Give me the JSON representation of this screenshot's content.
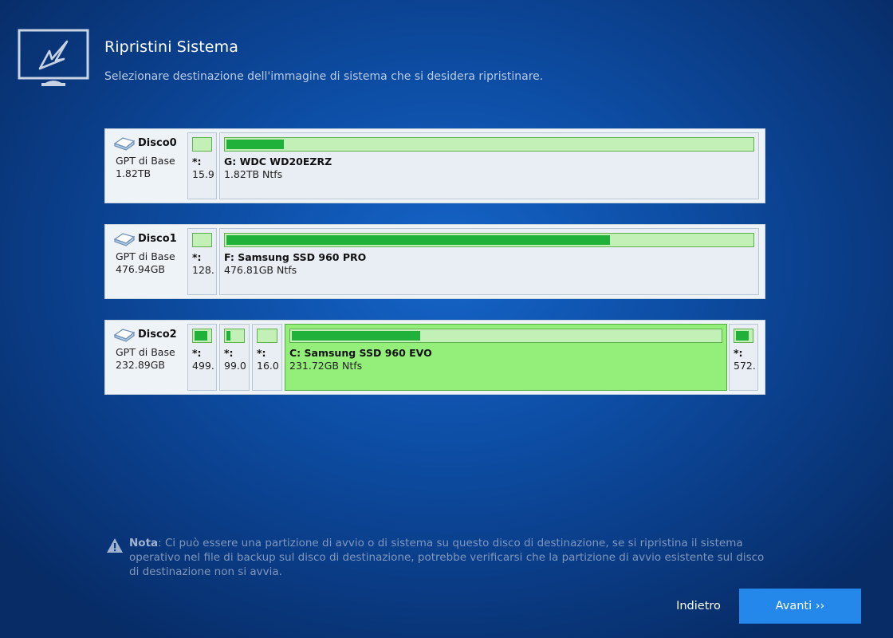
{
  "header": {
    "title": "Ripristini Sistema",
    "subtitle": "Selezionare destinazione dell'immagine di sistema che si desidera ripristinare."
  },
  "disks": [
    {
      "name": "Disco0",
      "type": "GPT di Base",
      "size": "1.82TB",
      "partitions": [
        {
          "label": "*:",
          "size": "15.9",
          "used_fraction": 0.0,
          "selected": false
        },
        {
          "label": "G: WDC WD20EZRZ",
          "size": "1.82TB Ntfs",
          "used_fraction": 0.11,
          "selected": false
        }
      ]
    },
    {
      "name": "Disco1",
      "type": "GPT di Base",
      "size": "476.94GB",
      "partitions": [
        {
          "label": "*:",
          "size": "128.",
          "used_fraction": 0.0,
          "selected": false
        },
        {
          "label": "F: Samsung SSD 960 PRO",
          "size": "476.81GB Ntfs",
          "used_fraction": 0.73,
          "selected": false
        }
      ]
    },
    {
      "name": "Disco2",
      "type": "GPT di Base",
      "size": "232.89GB",
      "partitions": [
        {
          "label": "*:",
          "size": "499.",
          "used_fraction": 0.85,
          "selected": false
        },
        {
          "label": "*:",
          "size": "99.0",
          "used_fraction": 0.25,
          "selected": false
        },
        {
          "label": "*:",
          "size": "16.0",
          "used_fraction": 0.0,
          "selected": false
        },
        {
          "label": "C: Samsung SSD 960 EVO",
          "size": "231.72GB Ntfs",
          "used_fraction": 0.3,
          "selected": true
        },
        {
          "label": "*:",
          "size": "572.",
          "used_fraction": 0.85,
          "selected": false
        }
      ]
    }
  ],
  "note": {
    "label": "Nota",
    "text": ": Ci può essere una partizione di avvio o di sistema su questo disco di destinazione, se si ripristina il sistema operativo nel file di backup sul disco di destinazione, potrebbe verificarsi che la partizione di avvio esistente sul disco di destinazione non si avvia."
  },
  "buttons": {
    "back": "Indietro",
    "next": "Avanti ››"
  },
  "icons": {
    "header": "monitor-restore-icon",
    "disk": "disk-icon",
    "note": "warning-icon"
  },
  "colors": {
    "accent": "#2487ea",
    "used": "#1fb13a",
    "selected": "#94ee7a"
  }
}
